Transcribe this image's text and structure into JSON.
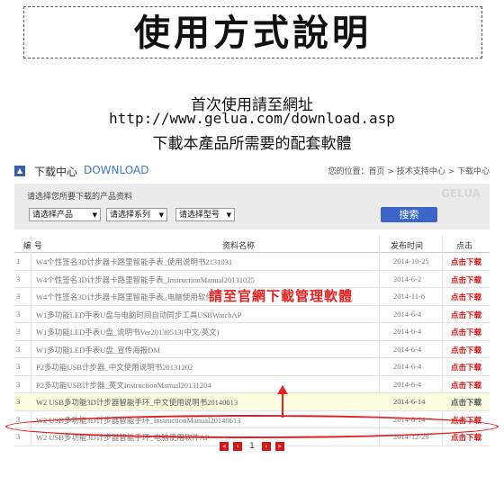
{
  "header": {
    "title": "使用方式說明",
    "line1": "首次使用請至網址",
    "line2": "http://www.gelua.com/download.asp",
    "line3": "下載本產品所需要的配套軟體"
  },
  "download": {
    "title": "下载中心",
    "title_en": "DOWNLOAD",
    "breadcrumb": "您的位置：首页 > 技术支持中心 > 下载中心"
  },
  "filter": {
    "label": "请选择您所要下载的产品资料",
    "product": "请选择产品",
    "series": "请选择系列",
    "model": "请选择型号",
    "search": "搜索",
    "logo_text": "GELUA"
  },
  "table": {
    "headers": [
      "编 号",
      "资料名称",
      "发布时间",
      "点击"
    ],
    "rows": [
      {
        "num": "1",
        "name": "W4个性签名3D计步器卡路里智能手表_使用说明书2131031",
        "date": "2014-10-25",
        "action": "点击下载"
      },
      {
        "num": "3",
        "name": "W4个性签名3D计步器卡路里智能手表_InstructionManual20131025",
        "date": "2014-6-2",
        "action": "点击下载"
      },
      {
        "num": "3",
        "name": "W4个性签名3D计步器卡路里智能手表_电脑使用软件",
        "date": "2014-11-6",
        "action": "点击下载"
      },
      {
        "num": "3",
        "name": "W1多功能LED手表U盘与电脑时间自动同步工具USBWatchAP",
        "date": "2014-6-4",
        "action": "点击下载"
      },
      {
        "num": "3",
        "name": "W1多功能LED手表U盘_说明书Ver20130513(中文/英文)",
        "date": "2014-6-4",
        "action": "点击下载"
      },
      {
        "num": "3",
        "name": "W1多功能LED手表U盘_宣传海报DM",
        "date": "2014-6-4",
        "action": "点击下载"
      },
      {
        "num": "3",
        "name": "P2多功能USB计步器_中文使用说明书20131202",
        "date": "2014-6-4",
        "action": "点击下载"
      },
      {
        "num": "3",
        "name": "P2多功能USB计步器_英文InstructionManual20131204",
        "date": "2014-6-4",
        "action": "点击下载"
      },
      {
        "num": "3",
        "name": "W2 USB多功能3D计步器智能手环_中文使用说明书20140613",
        "date": "2014-6-14",
        "action": "点击下载"
      },
      {
        "num": "3",
        "name": "W2 USB多功能3D计步器智能手环_InstructionManual20140613",
        "date": "2014-6-14",
        "action": "点击下载"
      },
      {
        "num": "3",
        "name": "W2 USB多功能3D计步器智能手环_电脑使用软件AP",
        "date": "2014-12-29",
        "action": "点击下载"
      }
    ]
  },
  "annotation": "請至官網下載管理軟體",
  "pager": {
    "first": "«",
    "prev": "‹",
    "page": "1",
    "next": "›",
    "last": "»"
  },
  "colors": {
    "accent": "#3b66c8",
    "download_red": "#e01010",
    "annotation_red": "#e82020"
  }
}
